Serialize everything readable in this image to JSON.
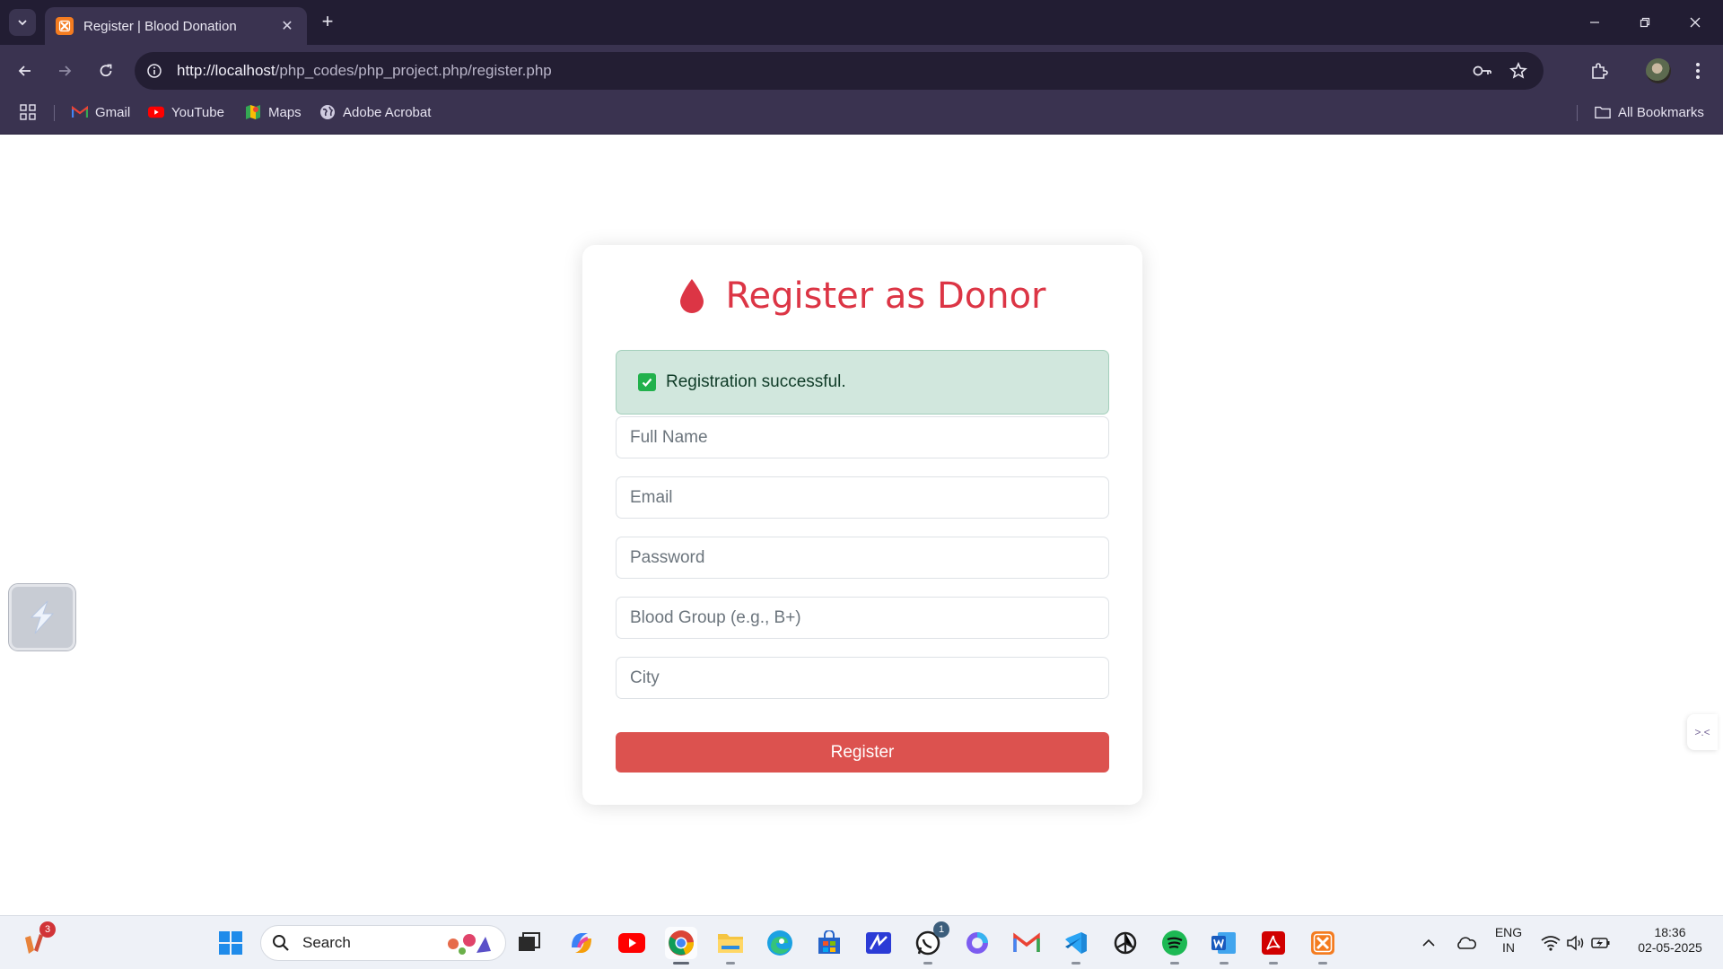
{
  "browser": {
    "tab_title": "Register | Blood Donation",
    "new_tab_label": "+",
    "url_host": "http://localhost",
    "url_path": "/php_codes/php_project.php/register.php"
  },
  "bookmarks": [
    {
      "label": "Gmail",
      "icon": "gmail-icon"
    },
    {
      "label": "YouTube",
      "icon": "youtube-icon"
    },
    {
      "label": "Maps",
      "icon": "maps-icon"
    },
    {
      "label": "Adobe Acrobat",
      "icon": "globe-icon"
    }
  ],
  "all_bookmarks_label": "All Bookmarks",
  "form": {
    "title": "Register as Donor",
    "success_message": "Registration successful.",
    "fields": {
      "full_name_placeholder": "Full Name",
      "email_placeholder": "Email",
      "password_placeholder": "Password",
      "blood_group_placeholder": "Blood Group (e.g., B+)",
      "city_placeholder": "City"
    },
    "submit_label": "Register"
  },
  "colors": {
    "accent_red": "#dc3545",
    "button_red": "#dc524f",
    "success_bg": "#d1e7dd"
  },
  "taskbar": {
    "search_label": "Search",
    "widget_badge": "3",
    "whatsapp_badge": "1",
    "language_line1": "ENG",
    "language_line2": "IN",
    "time": "18:36",
    "date": "02-05-2025"
  }
}
